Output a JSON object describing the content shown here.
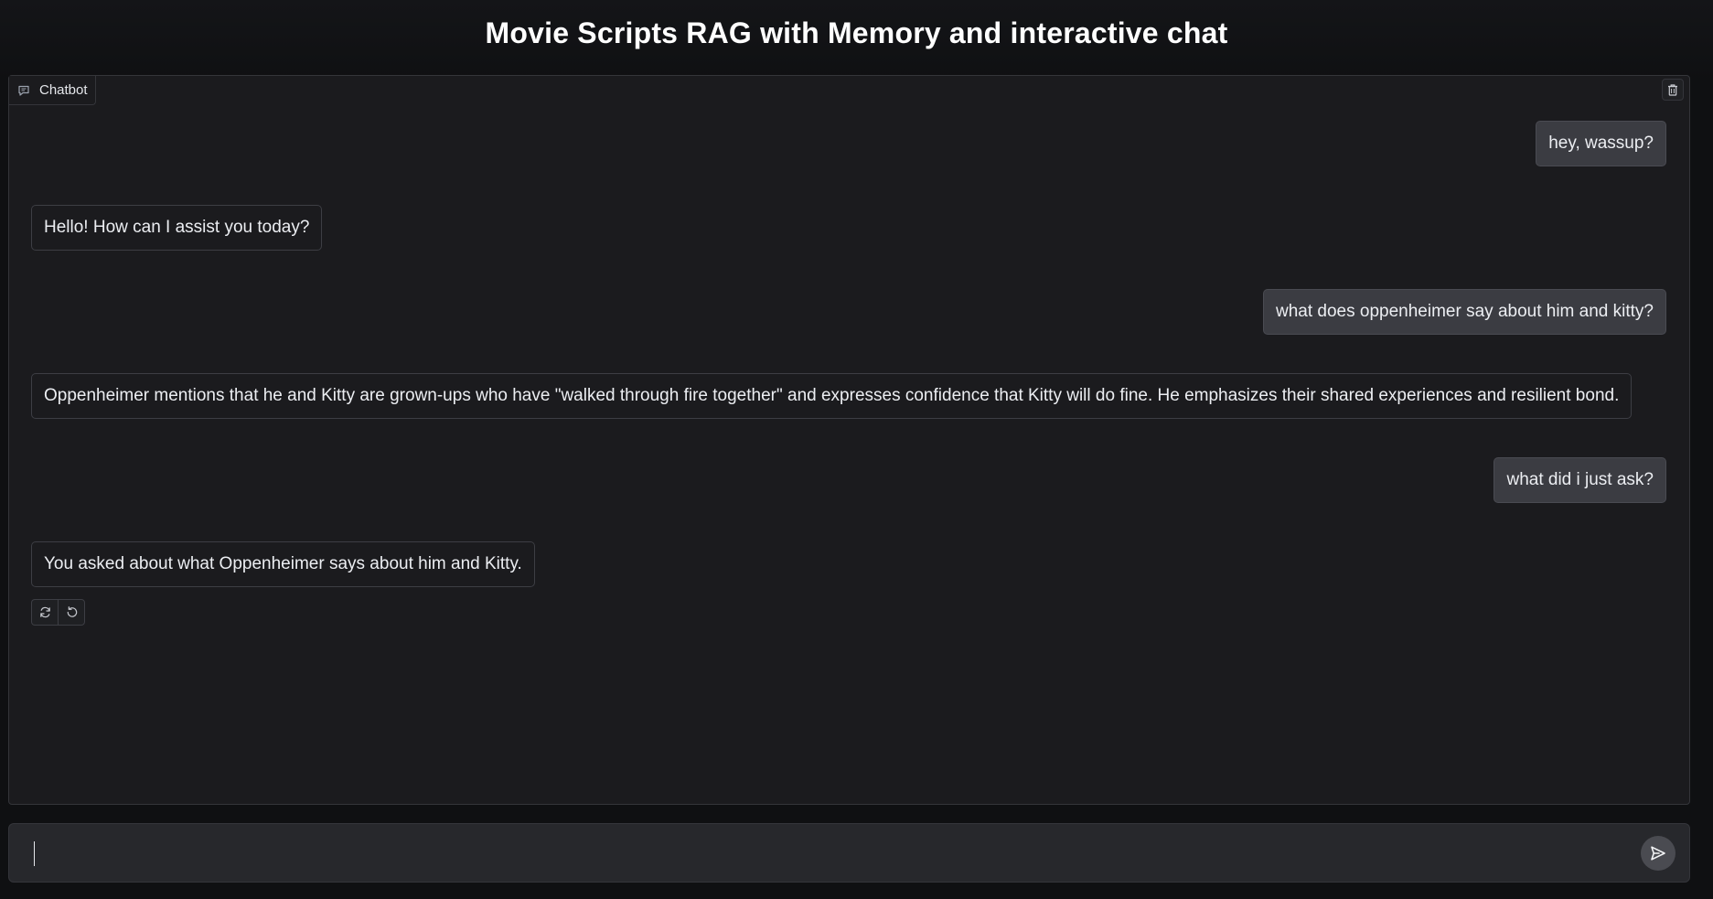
{
  "header": {
    "title": "Movie Scripts RAG with Memory and interactive chat"
  },
  "chat": {
    "tab_label": "Chatbot",
    "tab_icon": "chat-icon",
    "clear_icon": "trash-icon",
    "messages": [
      {
        "role": "user",
        "text": "hey, wassup?"
      },
      {
        "role": "bot",
        "text": "Hello! How can I assist you today?"
      },
      {
        "role": "user",
        "text": "what does oppenheimer say about him and kitty?"
      },
      {
        "role": "bot",
        "text": "Oppenheimer mentions that he and Kitty are grown-ups who have \"walked through fire together\" and expresses confidence that Kitty will do fine. He emphasizes their shared experiences and resilient bond."
      },
      {
        "role": "user",
        "text": "what did i just ask?"
      },
      {
        "role": "bot",
        "text": "You asked about what Oppenheimer says about him and Kitty."
      }
    ],
    "actions": [
      {
        "icon": "retry-icon"
      },
      {
        "icon": "undo-icon"
      }
    ]
  },
  "input": {
    "value": "",
    "placeholder": "",
    "send_icon": "send-icon"
  },
  "colors": {
    "background": "#0f1012",
    "panel": "#1b1b1e",
    "user_bubble": "#3b3c42",
    "border": "#34353a",
    "send_button": "#4a4b51"
  }
}
